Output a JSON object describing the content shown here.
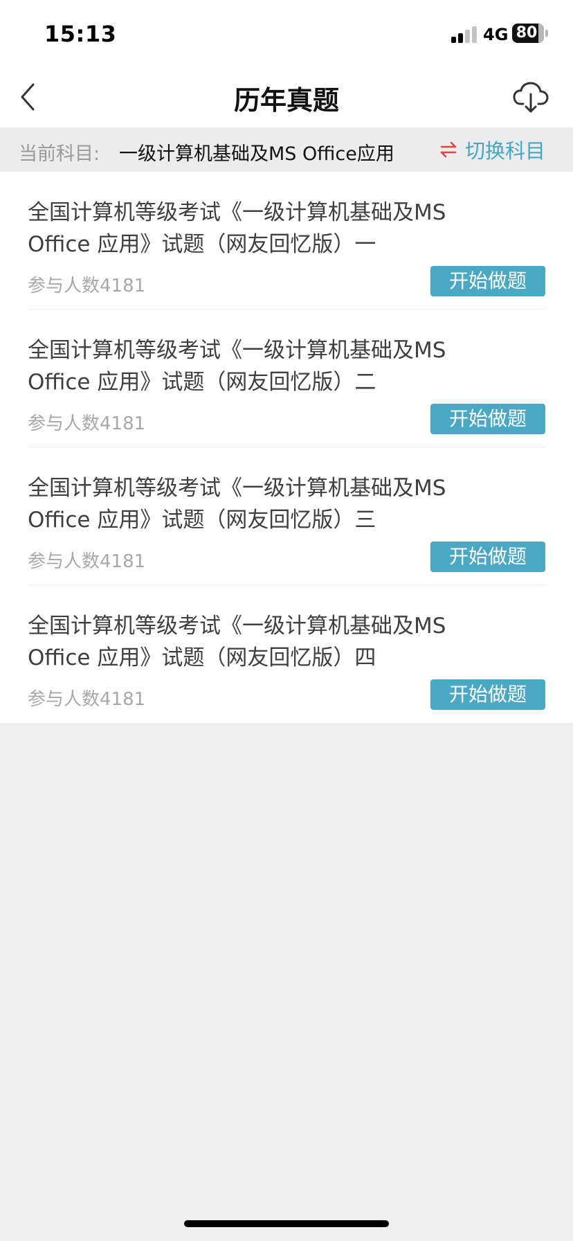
{
  "status_bar": {
    "time": "15:13",
    "network": "4G",
    "battery": "80",
    "battery_level_percent": 80
  },
  "header": {
    "title": "历年真题",
    "back_icon": "chevron-left-icon",
    "download_icon": "cloud-download-icon"
  },
  "subject_bar": {
    "label": "当前科目:",
    "current_subject": "一级计算机基础及MS Office应用",
    "switch_icon": "swap-arrows-icon",
    "switch_label": "切换科目",
    "switch_icon_color": "#e0473c",
    "accent_color": "#48a6c3"
  },
  "exams": [
    {
      "title": "全国计算机等级考试《一级计算机基础及MS Office 应用》试题（网友回忆版）一",
      "participants": "参与人数4181",
      "button": "开始做题"
    },
    {
      "title": "全国计算机等级考试《一级计算机基础及MS Office 应用》试题（网友回忆版）二",
      "participants": "参与人数4181",
      "button": "开始做题"
    },
    {
      "title": "全国计算机等级考试《一级计算机基础及MS Office 应用》试题（网友回忆版）三",
      "participants": "参与人数4181",
      "button": "开始做题"
    },
    {
      "title": "全国计算机等级考试《一级计算机基础及MS Office 应用》试题（网友回忆版）四",
      "participants": "参与人数4181",
      "button": "开始做题"
    }
  ],
  "colors": {
    "button_background": "#4aa8c5",
    "page_background": "#efefef"
  }
}
